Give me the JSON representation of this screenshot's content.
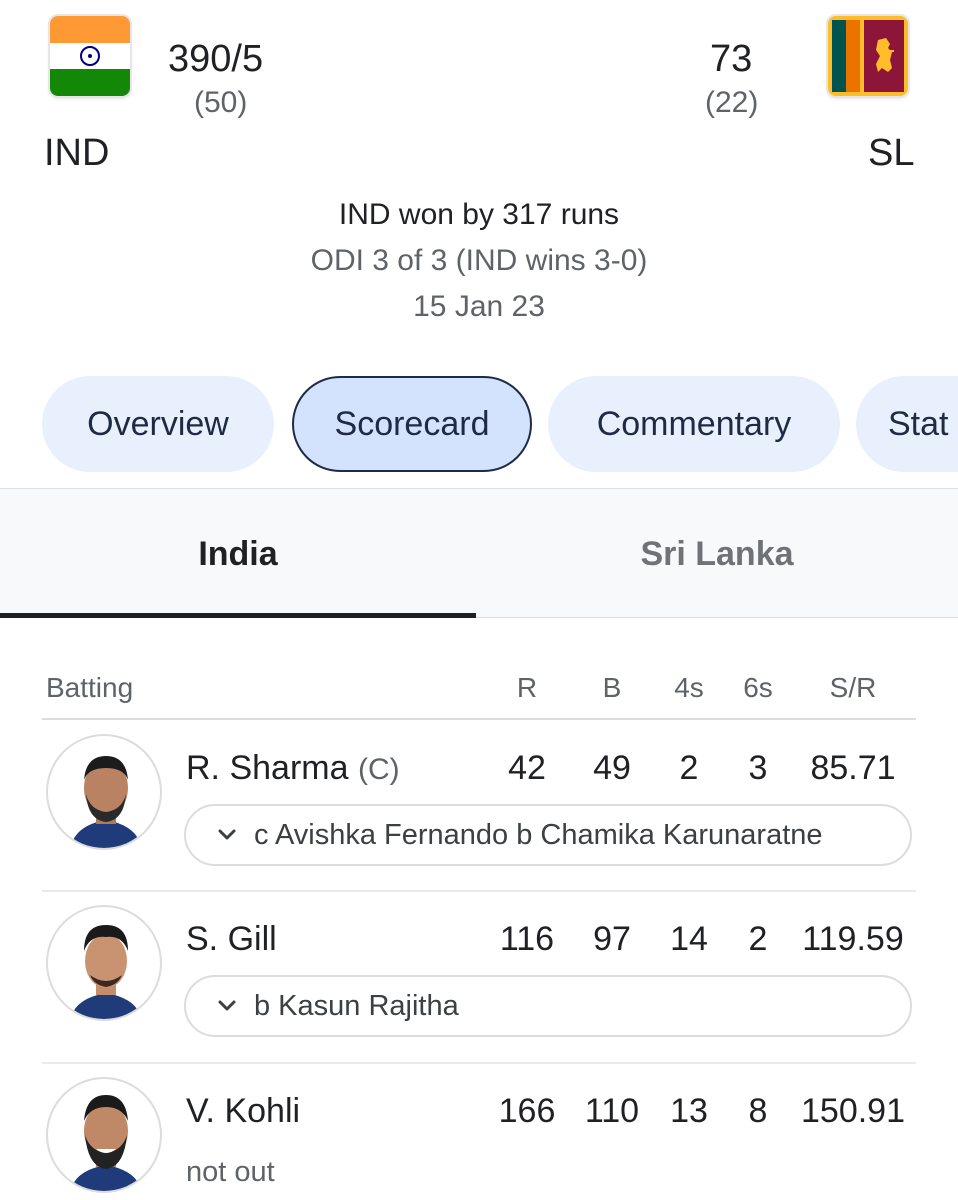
{
  "header": {
    "home": {
      "team": "IND",
      "score": "390/5",
      "overs": "(50)",
      "flag": "india-flag"
    },
    "away": {
      "team": "SL",
      "score": "73",
      "overs": "(22)",
      "flag": "sri-lanka-flag"
    },
    "result": "IND won by 317 runs",
    "series": "ODI 3 of 3 (IND wins 3-0)",
    "date": "15 Jan 23"
  },
  "chips": [
    "Overview",
    "Scorecard",
    "Commentary",
    "Stat"
  ],
  "active_chip": "Scorecard",
  "innings_tabs": [
    "India",
    "Sri Lanka"
  ],
  "active_innings": "India",
  "batting": {
    "headers": {
      "batting": "Batting",
      "r": "R",
      "b": "B",
      "fours": "4s",
      "sixes": "6s",
      "sr": "S/R"
    },
    "players": [
      {
        "name": "R. Sharma",
        "captain": "(C)",
        "r": "42",
        "b": "49",
        "fours": "2",
        "sixes": "3",
        "sr": "85.71",
        "dismissal": "c Avishka Fernando b Chamika Karunaratne"
      },
      {
        "name": "S. Gill",
        "captain": "",
        "r": "116",
        "b": "97",
        "fours": "14",
        "sixes": "2",
        "sr": "119.59",
        "dismissal": "b Kasun Rajitha"
      },
      {
        "name": "V. Kohli",
        "captain": "",
        "r": "166",
        "b": "110",
        "fours": "13",
        "sixes": "8",
        "sr": "150.91",
        "dismissal": "not out"
      }
    ]
  },
  "colors": {
    "chip_bg": "#e8f0fe",
    "chip_active_bg": "#d3e3fd",
    "chip_text": "#1f2a44",
    "muted_text": "#5f6368"
  }
}
